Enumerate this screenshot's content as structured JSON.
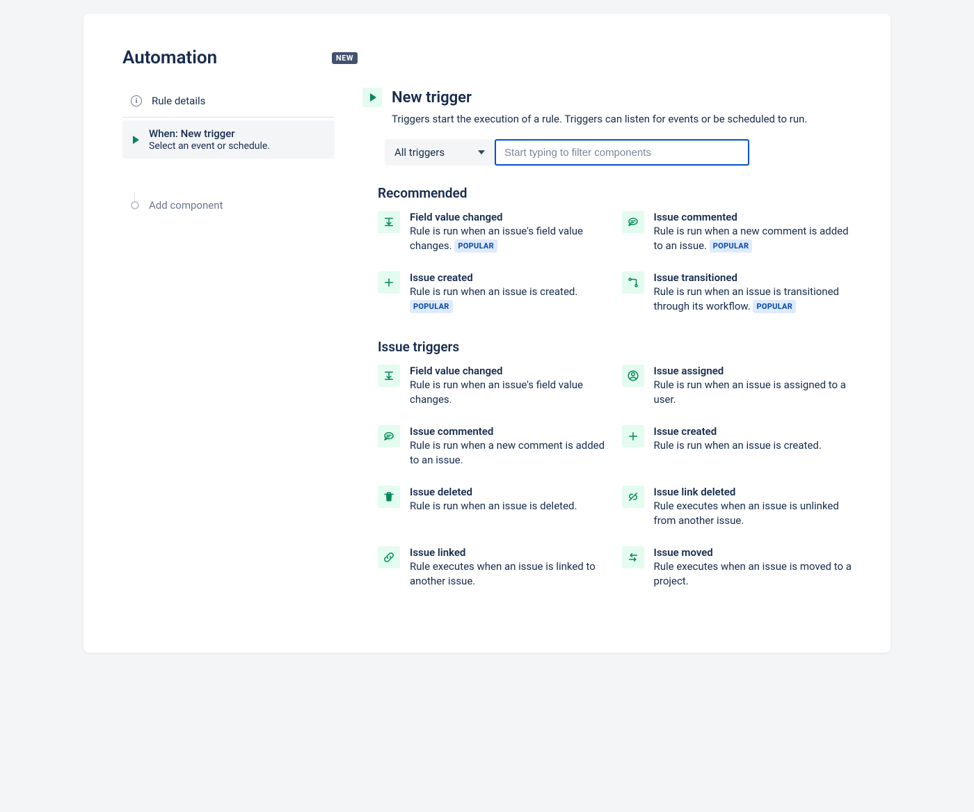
{
  "header": {
    "title": "Automation",
    "badge": "NEW"
  },
  "sidebar": {
    "rule_details": "Rule details",
    "new_trigger": {
      "title": "When: New trigger",
      "sub": "Select an event or schedule."
    },
    "add_component": "Add component"
  },
  "main": {
    "title": "New trigger",
    "description": "Triggers start the execution of a rule. Triggers can listen for events or be scheduled to run.",
    "filter_select": "All triggers",
    "search_placeholder": "Start typing to filter components"
  },
  "tags": {
    "popular": "POPULAR"
  },
  "sections": [
    {
      "title": "Recommended",
      "items": [
        {
          "icon": "field-change",
          "title": "Field value changed",
          "desc": "Rule is run when an issue's field value changes.",
          "popular": true
        },
        {
          "icon": "comment",
          "title": "Issue commented",
          "desc": "Rule is run when a new comment is added to an issue.",
          "popular": true
        },
        {
          "icon": "plus",
          "title": "Issue created",
          "desc": "Rule is run when an issue is created.",
          "popular": true
        },
        {
          "icon": "transition",
          "title": "Issue transitioned",
          "desc": "Rule is run when an issue is transitioned through its workflow.",
          "popular": true
        }
      ]
    },
    {
      "title": "Issue triggers",
      "items": [
        {
          "icon": "field-change",
          "title": "Field value changed",
          "desc": "Rule is run when an issue's field value changes.",
          "popular": false
        },
        {
          "icon": "person",
          "title": "Issue assigned",
          "desc": "Rule is run when an issue is assigned to a user.",
          "popular": false
        },
        {
          "icon": "comment",
          "title": "Issue commented",
          "desc": "Rule is run when a new comment is added to an issue.",
          "popular": false
        },
        {
          "icon": "plus",
          "title": "Issue created",
          "desc": "Rule is run when an issue is created.",
          "popular": false
        },
        {
          "icon": "trash",
          "title": "Issue deleted",
          "desc": "Rule is run when an issue is deleted.",
          "popular": false
        },
        {
          "icon": "unlink",
          "title": "Issue link deleted",
          "desc": "Rule executes when an issue is unlinked from another issue.",
          "popular": false
        },
        {
          "icon": "link",
          "title": "Issue linked",
          "desc": "Rule executes when an issue is linked to another issue.",
          "popular": false
        },
        {
          "icon": "move",
          "title": "Issue moved",
          "desc": "Rule executes when an issue is moved to a project.",
          "popular": false
        }
      ]
    }
  ]
}
